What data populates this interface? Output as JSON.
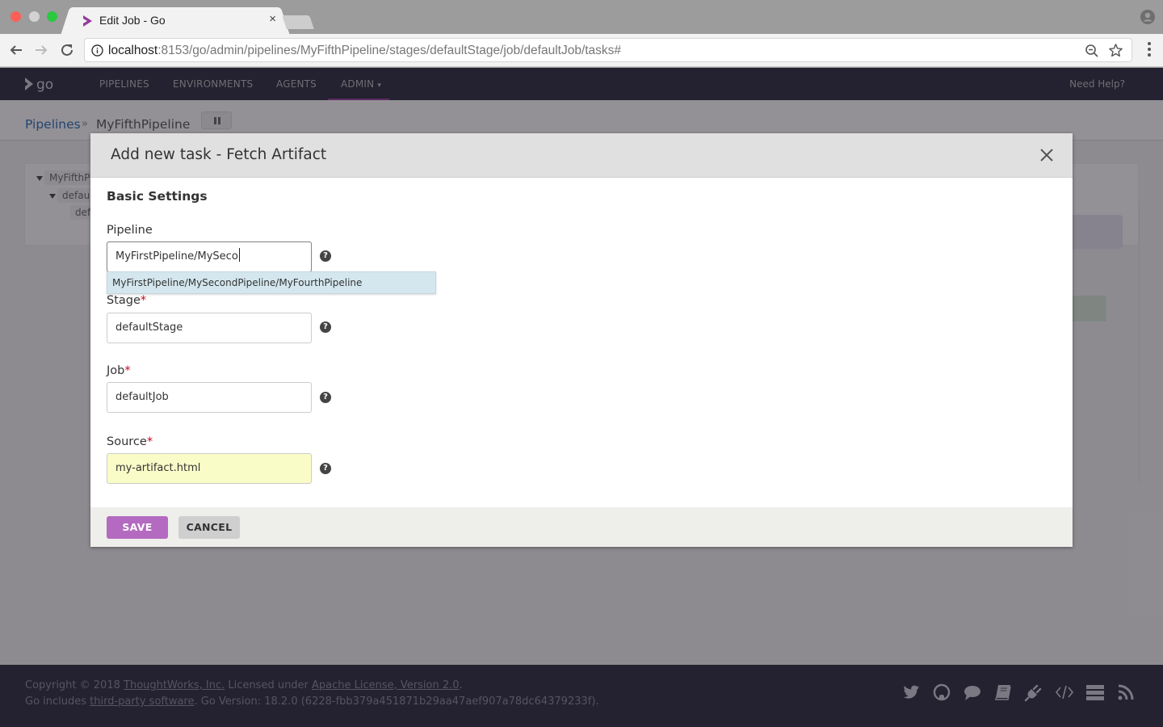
{
  "browser": {
    "tab_title": "Edit Job - Go",
    "tab_close": "×",
    "url_host": "localhost",
    "url_rest": ":8153/go/admin/pipelines/MyFifthPipeline/stages/defaultStage/job/defaultJob/tasks#"
  },
  "app_header": {
    "nav": [
      {
        "label": "PIPELINES"
      },
      {
        "label": "ENVIRONMENTS"
      },
      {
        "label": "AGENTS"
      },
      {
        "label": "ADMIN"
      }
    ],
    "help": "Need Help?"
  },
  "breadcrumb": {
    "root": "Pipelines",
    "separator": "»",
    "current": "MyFifthPipeline"
  },
  "tree": {
    "items": [
      {
        "label": "MyFifthPi"
      },
      {
        "label": "defaul"
      },
      {
        "label": "def"
      }
    ]
  },
  "modal": {
    "title": "Add new task - Fetch Artifact",
    "section_title": "Basic Settings",
    "fields": {
      "pipeline": {
        "label": "Pipeline",
        "value": "MyFirstPipeline/MySeco",
        "required": false
      },
      "stage": {
        "label": "Stage",
        "value": "defaultStage",
        "required": true
      },
      "job": {
        "label": "Job",
        "value": "defaultJob",
        "required": true
      },
      "source": {
        "label": "Source",
        "value": "my-artifact.html",
        "required": true
      }
    },
    "required_marker": "*",
    "help_glyph": "?",
    "autocomplete": {
      "suggestions": [
        "MyFirstPipeline/MySecondPipeline/MyFourthPipeline"
      ]
    },
    "buttons": {
      "save": "SAVE",
      "cancel": "CANCEL"
    }
  },
  "footer": {
    "line1": {
      "prefix": "Copyright © 2018 ",
      "company_link": "ThoughtWorks, Inc.",
      "middle": " Licensed under ",
      "license_link": "Apache License, Version 2.0",
      "suffix": "."
    },
    "line2": {
      "prefix": "Go includes ",
      "third_party_link": "third-party software",
      "suffix": ". Go Version: 18.2.0 (6228-fbb379a451871b29aa47aef907a78dc64379233f)."
    },
    "icons": [
      "twitter-icon",
      "github-icon",
      "chat-icon",
      "docs-icon",
      "plugin-icon",
      "api-icon",
      "server-icon",
      "rss-icon"
    ]
  },
  "colors": {
    "brand_purple": "#943a9e",
    "save_button": "#b36ac0",
    "autocomplete_highlight": "#d4e7ee",
    "autofill_yellow": "#fafcc8",
    "required": "#d0021b"
  }
}
